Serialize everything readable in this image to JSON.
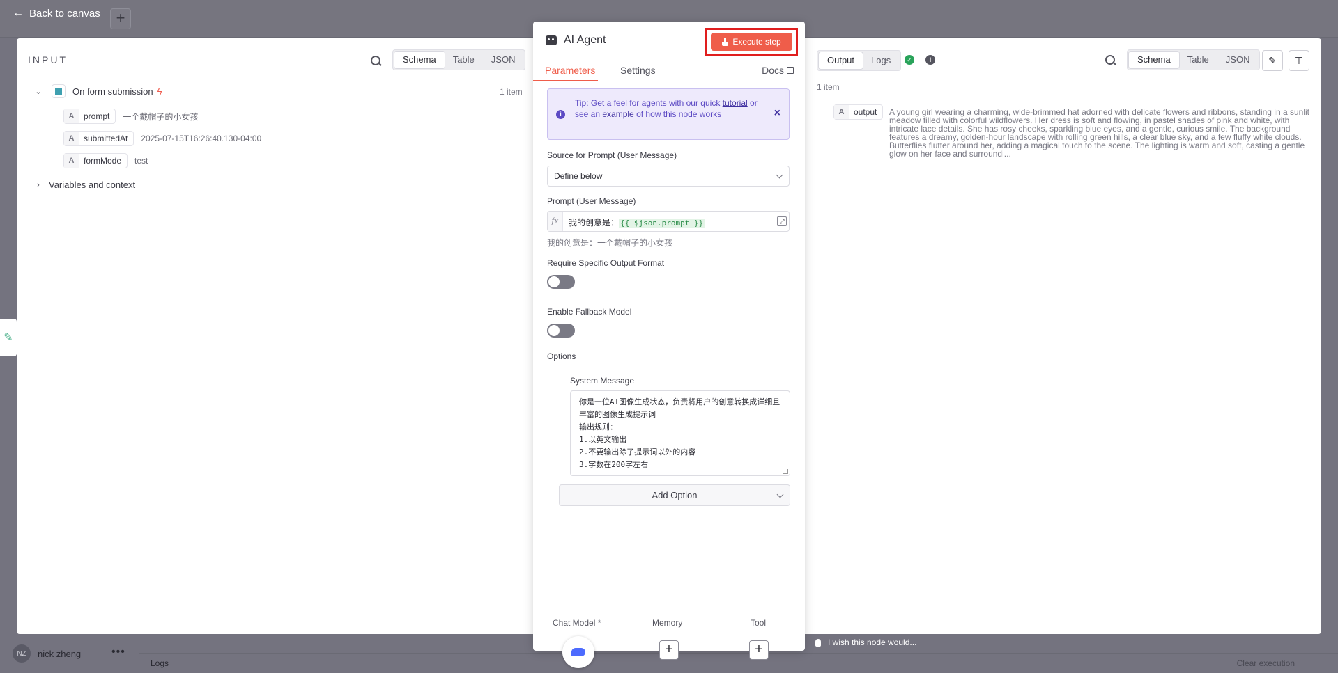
{
  "background": {
    "back_label": "Back to canvas",
    "user_initials": "NZ",
    "user_name": "nick zheng",
    "logs_label": "Logs",
    "clear_label": "Clear execution",
    "wish_label": "I wish this node would..."
  },
  "input": {
    "title": "INPUT",
    "views": [
      "Schema",
      "Table",
      "JSON"
    ],
    "active_view": "Schema",
    "node_name": "On form submission",
    "item_count": "1 item",
    "fields": [
      {
        "name": "prompt",
        "value": "一个戴帽子的小女孩"
      },
      {
        "name": "submittedAt",
        "value": "2025-07-15T16:26:40.130-04:00"
      },
      {
        "name": "formMode",
        "value": "test"
      }
    ],
    "variables_label": "Variables and context"
  },
  "node": {
    "title": "AI Agent",
    "execute_label": "Execute step",
    "tabs": [
      "Parameters",
      "Settings"
    ],
    "active_tab": "Parameters",
    "docs_label": "Docs",
    "tip": {
      "prefix": "Tip: Get a feel for agents with our quick",
      "link1": "tutorial",
      "middle": "or see an",
      "link2": "example",
      "suffix": "of how this node works"
    },
    "source_label": "Source for Prompt (User Message)",
    "source_value": "Define below",
    "prompt_label": "Prompt (User Message)",
    "prompt_text": "我的创意是：",
    "prompt_expr": "{{ $json.prompt }}",
    "prompt_preview": "我的创意是：一个戴帽子的小女孩",
    "output_format_label": "Require Specific Output Format",
    "fallback_label": "Enable Fallback Model",
    "options_label": "Options",
    "system_message_label": "System Message",
    "system_message": "你是一位AI图像生成状态，负责将用户的创意转换成详细且丰富的图像生成提示词\n输出规则：\n1.以英文输出\n2.不要输出除了提示词以外的内容\n3.字数在200字左右",
    "add_option_label": "Add Option",
    "sub_nodes": [
      "Chat Model *",
      "Memory",
      "Tool"
    ]
  },
  "output": {
    "tabs": [
      "Output",
      "Logs"
    ],
    "active_tab": "Output",
    "views": [
      "Schema",
      "Table",
      "JSON"
    ],
    "active_view": "Schema",
    "item_count": "1 item",
    "field_name": "output",
    "field_value": "A young girl wearing a charming, wide-brimmed hat adorned with delicate flowers and ribbons, standing in a sunlit meadow filled with colorful wildflowers. Her dress is soft and flowing, in pastel shades of pink and white, with intricate lace details. She has rosy cheeks, sparkling blue eyes, and a gentle, curious smile. The background features a dreamy, golden-hour landscape with rolling green hills, a clear blue sky, and a few fluffy white clouds. Butterflies flutter around her, adding a magical touch to the scene. The lighting is warm and soft, casting a gentle glow on her face and surroundi..."
  },
  "colors": {
    "accent": "#ef5d4a",
    "highlight_border": "#e01e1e",
    "tip_bg": "#eeeafc",
    "success": "#29a35a"
  }
}
